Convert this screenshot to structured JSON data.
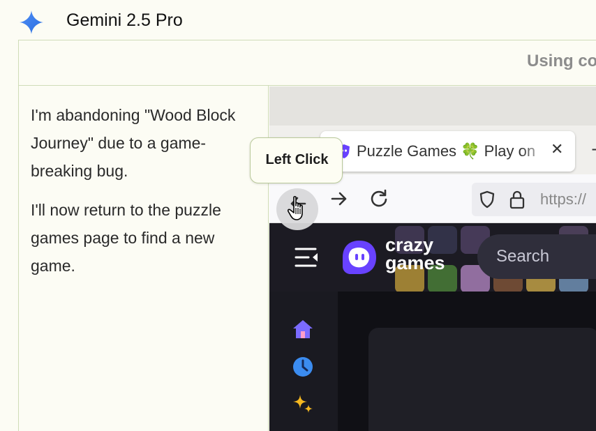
{
  "header": {
    "model_name": "Gemini 2.5 Pro",
    "icon": "gemini-sparkle-icon"
  },
  "top_band": {
    "text": "Using co"
  },
  "message": {
    "paragraph_1": "I'm abandoning \"Wood Block Journey\" due to a game-breaking bug.",
    "paragraph_2": "I'll now return to the puzzle games page to find a new game."
  },
  "action": {
    "label": "Left Click",
    "cursor": "hand-pointer-icon"
  },
  "browser": {
    "tab": {
      "title": "Puzzle Games 🍀 Play on",
      "close": "✕",
      "favicon": "crazygames-shield-icon"
    },
    "new_tab": "+",
    "nav": {
      "back": "back-arrow-icon",
      "forward": "forward-arrow-icon",
      "reload": "reload-icon"
    },
    "url_text": "https://"
  },
  "site": {
    "logo_line1": "crazy",
    "logo_line2": "games",
    "search_placeholder": "Search",
    "rail_icons": [
      "home-icon",
      "clock-icon",
      "sparkle-icon"
    ],
    "accent_color": "#6842ff"
  }
}
